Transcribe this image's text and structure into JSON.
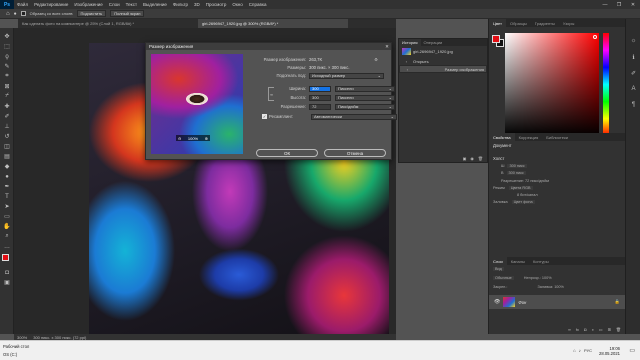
{
  "app": {
    "logo": "Ps",
    "menu": [
      "Файл",
      "Редактирование",
      "Изображение",
      "Слои",
      "Текст",
      "Выделение",
      "Фильтр",
      "3D",
      "Просмотр",
      "Окно",
      "Справка"
    ]
  },
  "window_controls": {
    "minimize": "—",
    "maximize": "❐",
    "close": "✕"
  },
  "options_bar": {
    "checkbox_label": "Образец со всех слоев",
    "btn1": "Подчистить",
    "btn2": "Полный экран"
  },
  "tabs": [
    {
      "label": "Как сделать фото на компьютере @ 25% (Слой 1, RGB/8#) *"
    },
    {
      "label": "girl-2696947_1920.jpg @ 300% (RGB/8*) *",
      "active": true
    }
  ],
  "dialog": {
    "title": "Размер изображения",
    "close": "✕",
    "image_size_label": "Размер изображения:",
    "image_size_value": "263,7K",
    "dimensions_label": "Размеры:",
    "dimensions_value": "300 пикс. × 300 пикс.",
    "fit_label": "Подогнать под:",
    "fit_value": "Исходный размер",
    "width_label": "Ширина:",
    "width_value": "300",
    "width_unit": "Пиксели",
    "height_label": "Высота:",
    "height_value": "300",
    "height_unit": "Пиксели",
    "resolution_label": "Разрешение:",
    "resolution_value": "72",
    "resolution_unit": "Пикс/дюйм",
    "resample_label": "Ресамплинг:",
    "resample_value": "Автоматически",
    "zoom_value": "100%",
    "ok": "ОК",
    "cancel": "Отмена"
  },
  "history": {
    "tabs": [
      "История",
      "Операции"
    ],
    "snapshot": "girl-2696947_1920.jpg",
    "items": [
      {
        "label": "Открыть"
      },
      {
        "label": "Размер изображения",
        "selected": true
      }
    ]
  },
  "color_panel": {
    "tabs": [
      "Цвет",
      "Образцы",
      "Градиенты",
      "Узоры"
    ],
    "foreground": "#e20d13",
    "background": "#111111"
  },
  "properties": {
    "tabs": [
      "Свойства",
      "Коррекция",
      "Библиотеки"
    ],
    "doc_label": "Документ",
    "canvas_label": "Холст",
    "w_label": "Ш",
    "w_value": "300 пикс",
    "h_label": "В",
    "h_value": "300 пикс",
    "res_label": "Разрешение: 72 пикс/дюйм",
    "mode_label": "Режим",
    "mode_value": "Цвета RGB",
    "bits_value": "8 бит/канал",
    "fill_label": "Заливка",
    "fill_value": "Цвет фона"
  },
  "layers": {
    "tabs": [
      "Слои",
      "Каналы",
      "Контуры"
    ],
    "kind_label": "Вид",
    "blend_mode": "Обычные",
    "opacity_label": "Непрозр.: 100%",
    "lock_label": "Закреп.:",
    "fill_label": "Заливка: 100%",
    "layer_name": "Фон"
  },
  "status_bar": {
    "zoom": "300%",
    "info": "300 пикс. x 300 пикс. (72 ppi)"
  },
  "taskbar": {
    "left_line1": "Рабочий стол",
    "left_line2": "OS (C:)",
    "lang": "РУС",
    "time": "19:06",
    "date": "28.05.2021"
  }
}
